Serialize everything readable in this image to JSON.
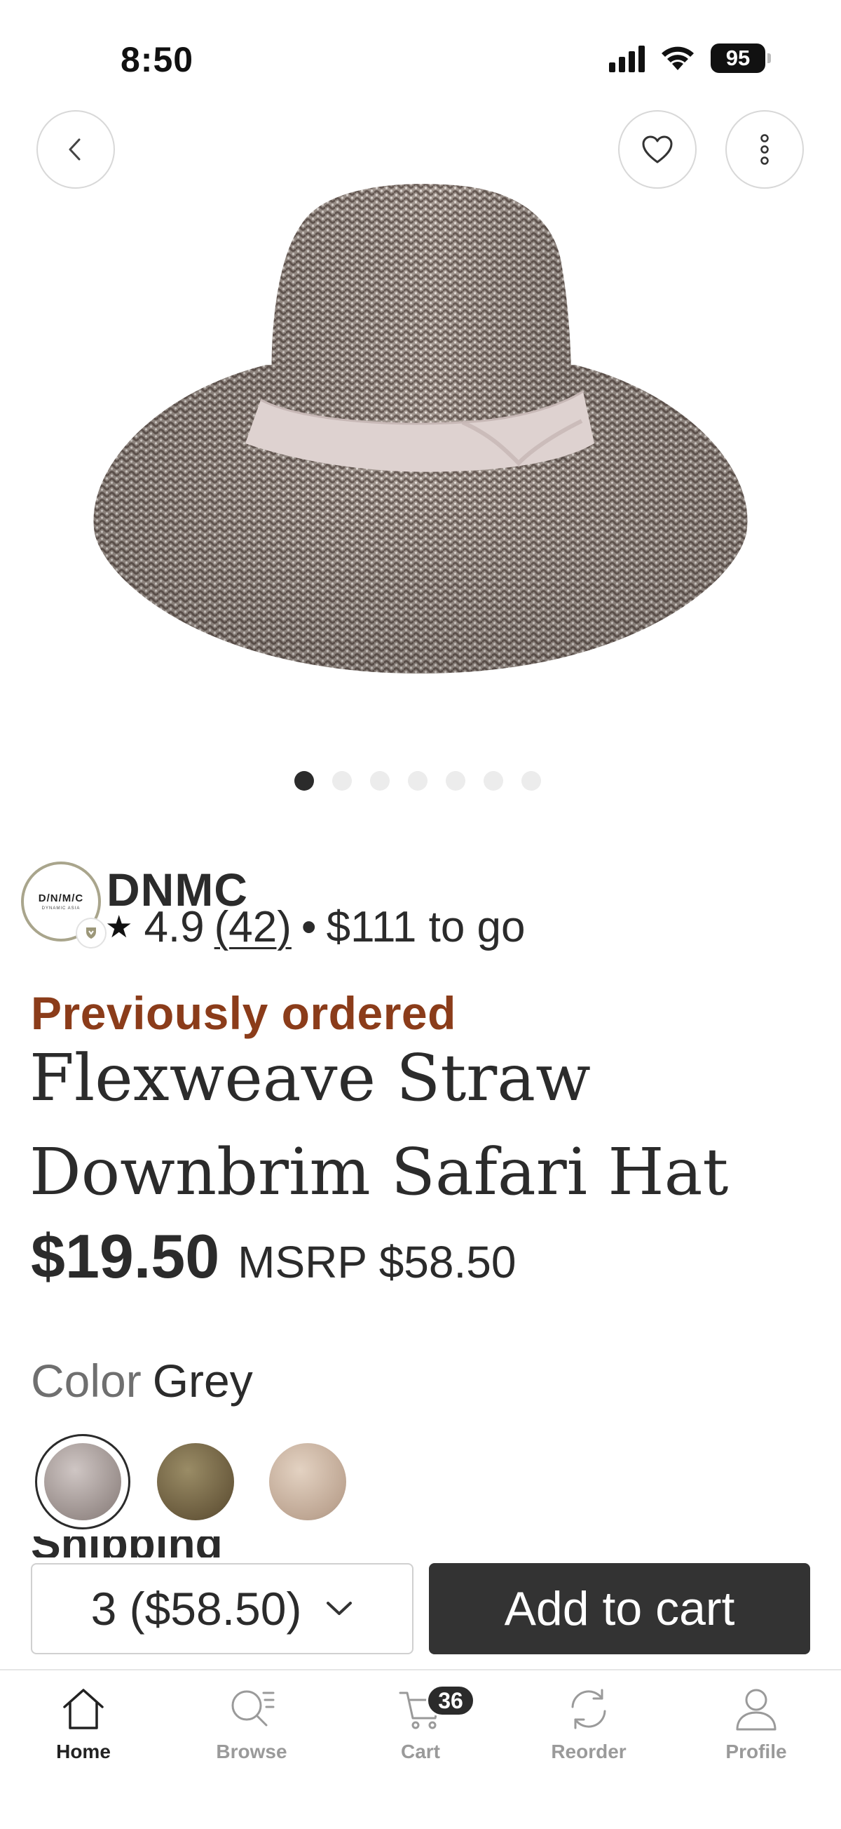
{
  "status_bar": {
    "time": "8:50",
    "battery": "95",
    "icons": [
      "cellular-signal-icon",
      "wifi-icon",
      "battery-icon"
    ]
  },
  "top_actions": {
    "back_icon": "chevron-left-icon",
    "favorite_icon": "heart-icon",
    "more_icon": "vertical-dots-icon"
  },
  "gallery": {
    "image_icon": "straw-safari-hat-photo",
    "total_images": 7,
    "active_index": 0
  },
  "brand": {
    "logo_text": "D/N/M/C",
    "logo_subtext": "DYNAMIC ASIA",
    "name": "DNMC",
    "rating": "4.9",
    "review_count": "(42)",
    "separator": "•",
    "min_order_text": "$111 to go"
  },
  "product": {
    "previously_ordered": "Previously ordered",
    "title_line1": "Flexweave Straw",
    "title_line2": "Downbrim Safari Hat",
    "price": "$19.50",
    "msrp": "MSRP $58.50"
  },
  "color": {
    "label": "Color",
    "selected": "Grey",
    "swatches": [
      "Grey",
      "Olive",
      "Tan"
    ]
  },
  "next_section_peek": "Shipping",
  "actions": {
    "quantity": "3 ($58.50)",
    "add_to_cart": "Add to cart"
  },
  "tab_bar": {
    "home": "Home",
    "browse": "Browse",
    "cart": "Cart",
    "cart_count": "36",
    "reorder": "Reorder",
    "profile": "Profile",
    "active": "home"
  },
  "colors": {
    "accent_brown": "#8b3c1a",
    "primary_dark": "#333333",
    "text": "#2b2b2b",
    "muted": "#9a9a9a"
  }
}
